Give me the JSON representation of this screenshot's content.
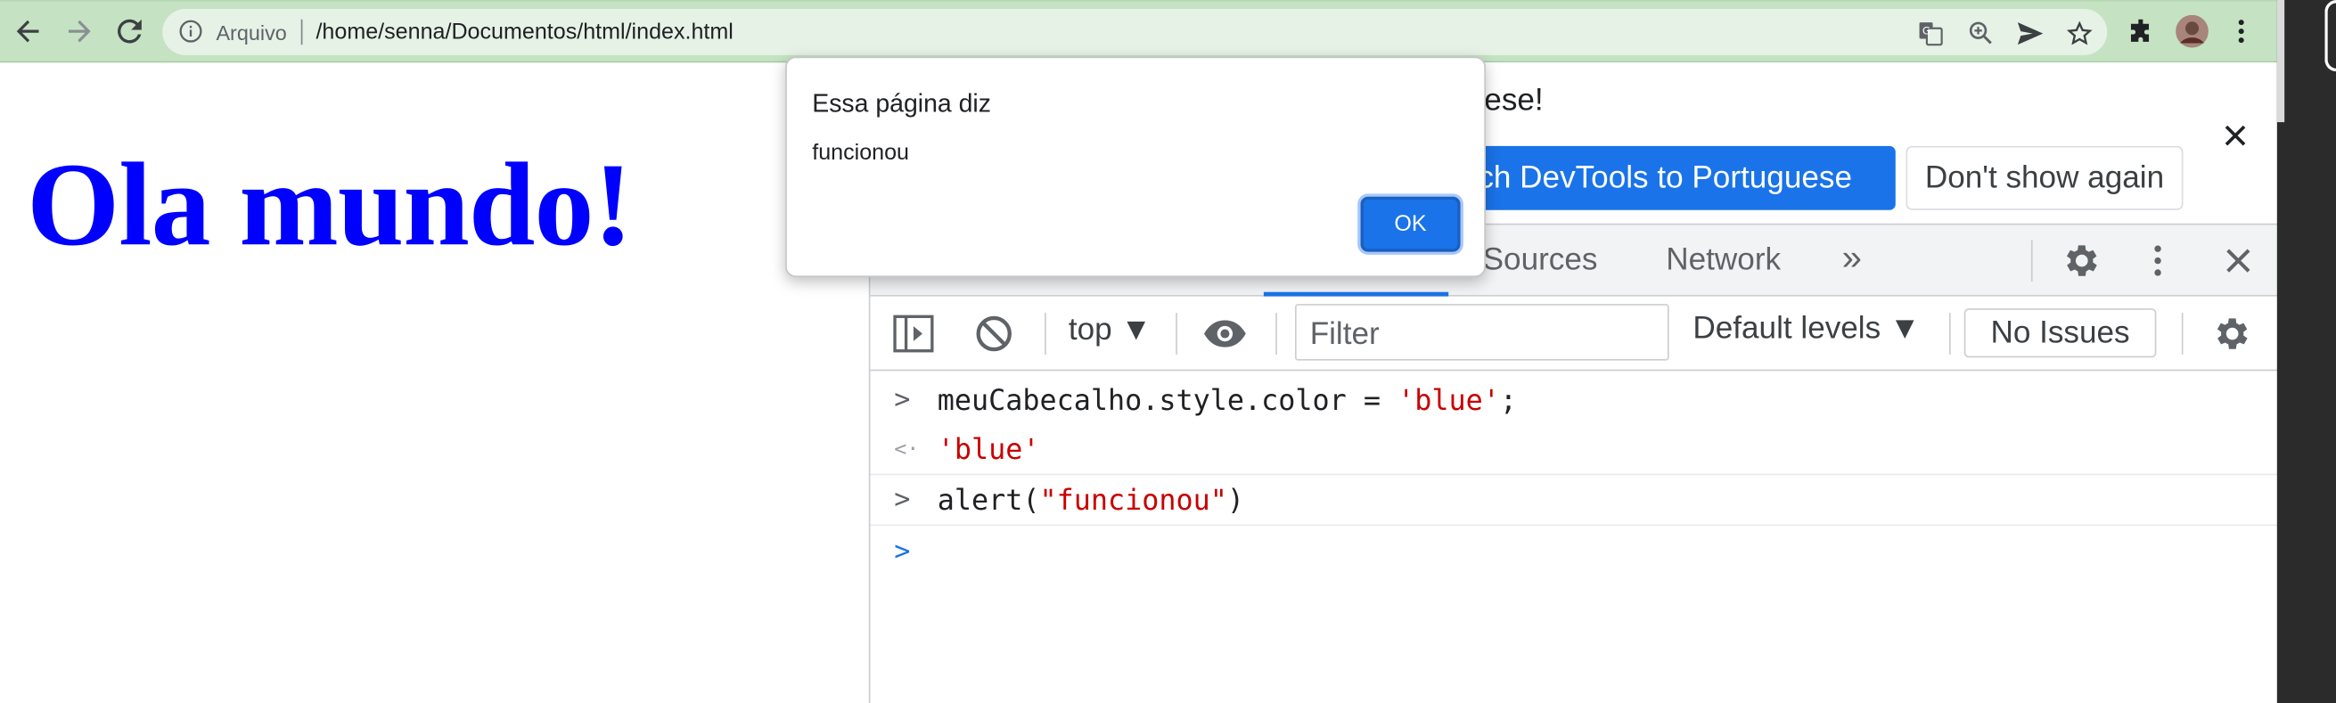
{
  "browser": {
    "omnibox": {
      "security_label": "Arquivo",
      "url": "/home/senna/Documentos/html/index.html"
    },
    "icons": [
      "back-icon",
      "forward-icon",
      "reload-icon",
      "info-icon",
      "translate-icon",
      "zoom-icon",
      "send-icon",
      "star-icon",
      "extensions-icon",
      "avatar",
      "more-vert-icon"
    ]
  },
  "page": {
    "heading": "Ola mundo!",
    "heading_color": "#0000ff"
  },
  "alert": {
    "title": "Essa página diz",
    "message": "funcionou",
    "ok_label": "OK"
  },
  "devtools": {
    "infobar": {
      "message_tail": "ese!",
      "switch_label_visible": "tch DevTools to Portuguese",
      "dont_show_label": "Don't show again"
    },
    "tabs": {
      "sources": "Sources",
      "network": "Network",
      "more": "»"
    },
    "console_toolbar": {
      "context": "top ▼",
      "filter_placeholder": "Filter",
      "levels": "Default levels ▼",
      "issues": "No Issues"
    },
    "console": {
      "line1_code_a": "meuCabecalho.style.color = ",
      "line1_str": "'blue'",
      "line1_code_b": ";",
      "line2_result": "'blue'",
      "line3_code_a": "alert(",
      "line3_str": "\"funcionou\"",
      "line3_code_b": ")"
    },
    "accent_color": "#1a73e8"
  }
}
